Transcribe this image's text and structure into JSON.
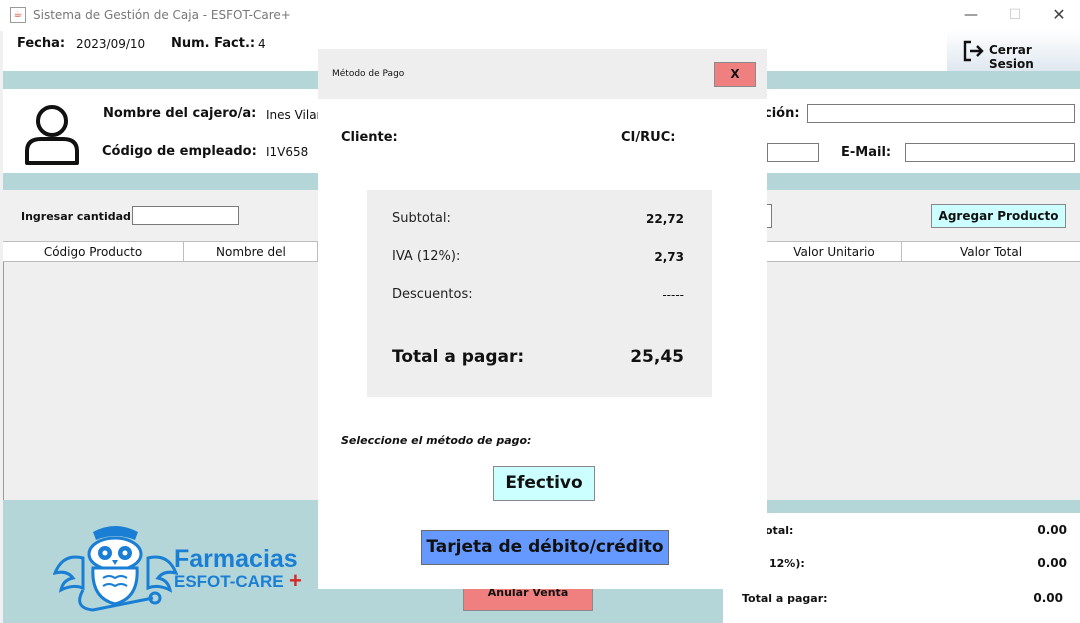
{
  "window": {
    "title": "Sistema de Gestión de Caja - ESFOT-Care+",
    "app_icon": "java-cup-icon"
  },
  "header": {
    "fecha_label": "Fecha:",
    "fecha_value": "2023/09/10",
    "factura_label": "Num. Fact.:",
    "factura_value": "4",
    "logout_label": "Cerrar Sesion"
  },
  "cashier": {
    "name_label": "Nombre del cajero/a:",
    "name_value": "Ines Vilar",
    "code_label": "Código de empleado:",
    "code_value": "I1V658",
    "direccion_label": "ción:",
    "email_label": "E-Mail:"
  },
  "product_entry": {
    "cantidad_label": "Ingresar cantidad:",
    "add_button": "Agregar Producto"
  },
  "table": {
    "columns": [
      "Código Producto",
      "Nombre del produ",
      "Valor Unitario",
      "Valor Total"
    ],
    "rows": []
  },
  "brand": {
    "name": "Farmacias",
    "sub": "ESFOT-CARE",
    "plus": "+",
    "colors": {
      "blue": "#1a7fd4",
      "red": "#d62828"
    }
  },
  "bottom": {
    "anular_button": "Anular Venta",
    "subtotal_label": "otal:",
    "subtotal_value": "0.00",
    "iva_label": "12%):",
    "iva_value": "0.00",
    "total_label": "Total a pagar:",
    "total_value": "0.00"
  },
  "modal": {
    "title": "Método de Pago",
    "close_label": "X",
    "cliente_label": "Cliente:",
    "ciruc_label": "CI/RUC:",
    "summary": {
      "subtotal_label": "Subtotal:",
      "subtotal_value": "22,72",
      "iva_label": "IVA (12%):",
      "iva_value": "2,73",
      "descuentos_label": "Descuentos:",
      "descuentos_value": "-----",
      "total_label": "Total a pagar:",
      "total_value": "25,45"
    },
    "prompt": "Seleccione el método de pago:",
    "efectivo_button": "Efectivo",
    "tarjeta_button": "Tarjeta de débito/crédito"
  }
}
